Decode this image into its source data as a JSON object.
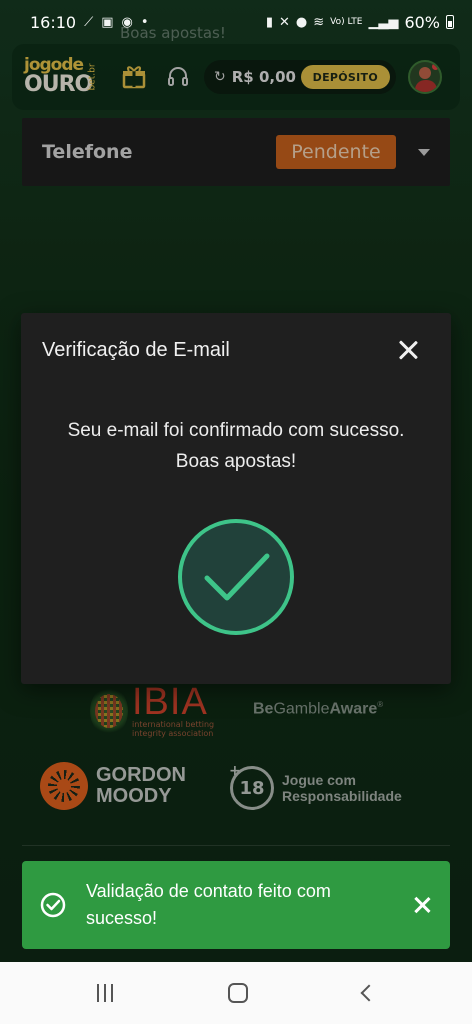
{
  "status_bar": {
    "time": "16:10",
    "battery": "60%",
    "network": "Vo) LTE"
  },
  "header": {
    "behind_text": "Boas apostas!",
    "logo_top": "jogode",
    "logo_bottom": "OURO",
    "logo_suffix": "bet.br",
    "balance": "R$ 0,00",
    "deposit_label": "DEPÓSITO"
  },
  "phone_row": {
    "label": "Telefone",
    "status": "Pendente"
  },
  "partners": {
    "ibia_title": "IBIA",
    "ibia_sub_1": "international betting",
    "ibia_sub_2": "integrity association",
    "gamble_be": "Be",
    "gamble_rest": "Gamble",
    "gamble_aware": "Aware",
    "gordon_line1": "GORDON",
    "gordon_line2": "MOODY",
    "age": "18",
    "age_line1": "Jogue com",
    "age_line2": "Responsabilidade"
  },
  "modal": {
    "title": "Verificação de E-mail",
    "message": "Seu e-mail foi confirmado com sucesso. Boas apostas!"
  },
  "toast": {
    "message": "Validação de contato feito com sucesso!"
  },
  "colors": {
    "brand_gold": "#e3c04a",
    "pending_orange": "#c8621c",
    "success_green": "#2f9a41",
    "check_ring": "#3ec489"
  }
}
